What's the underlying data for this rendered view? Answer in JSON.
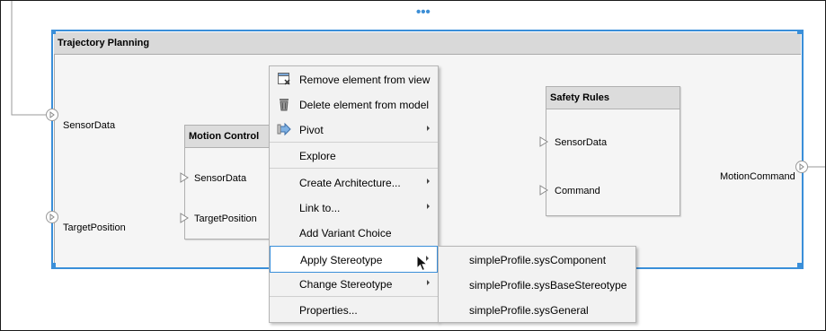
{
  "canvas": {
    "more_indicator": "•••",
    "accent_color": "#3a8fd9"
  },
  "component": {
    "title": "Trajectory Planning",
    "ports": {
      "sensor_data": "SensorData",
      "target_position": "TargetPosition",
      "motion_command": "MotionCommand"
    }
  },
  "blocks": {
    "motion_control": {
      "title": "Motion Control",
      "ports": [
        "SensorData",
        "TargetPosition"
      ]
    },
    "safety_rules": {
      "title": "Safety Rules",
      "ports": [
        "SensorData",
        "Command"
      ]
    }
  },
  "context_menu": {
    "items": [
      {
        "label": "Remove element from view",
        "icon": "remove-from-view-icon"
      },
      {
        "label": "Delete element from model",
        "icon": "trash-icon"
      },
      {
        "label": "Pivot",
        "icon": "pivot-icon",
        "submenu": true
      },
      {
        "label": "Explore"
      },
      {
        "label": "Create Architecture...",
        "submenu": true
      },
      {
        "label": "Link to...",
        "submenu": true
      },
      {
        "label": "Add Variant Choice"
      },
      {
        "label": "Apply Stereotype",
        "submenu": true,
        "highlighted": true
      },
      {
        "label": "Change Stereotype",
        "submenu": true
      },
      {
        "label": "Properties..."
      }
    ]
  },
  "stereotype_submenu": {
    "items": [
      "simpleProfile.sysComponent",
      "simpleProfile.sysBaseStereotype",
      "simpleProfile.sysGeneral"
    ]
  }
}
